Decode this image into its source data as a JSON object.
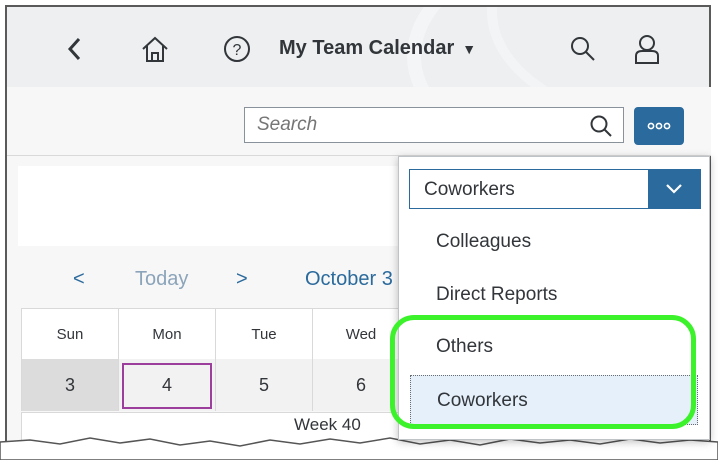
{
  "header": {
    "title": "My Team Calendar",
    "back_icon": "chevron-left-icon",
    "home_icon": "home-icon",
    "help_icon": "help-icon",
    "search_icon": "search-icon",
    "user_icon": "user-icon"
  },
  "toolbar": {
    "search_placeholder": "Search",
    "more_icon": "more-icon"
  },
  "calendar": {
    "nav": {
      "prev": "<",
      "today": "Today",
      "next": ">",
      "month": "October 3"
    },
    "days": [
      {
        "name": "Sun",
        "num": "3"
      },
      {
        "name": "Mon",
        "num": "4"
      },
      {
        "name": "Tue",
        "num": "5"
      },
      {
        "name": "Wed",
        "num": "6"
      }
    ],
    "week_label": "Week 40"
  },
  "dropdown": {
    "selected": "Coworkers",
    "options": [
      "Colleagues",
      "Direct Reports",
      "Others",
      "Coworkers"
    ]
  },
  "colors": {
    "accent": "#2b6a9c",
    "highlight": "#3cf22a",
    "today_border": "#9c3f9c"
  }
}
